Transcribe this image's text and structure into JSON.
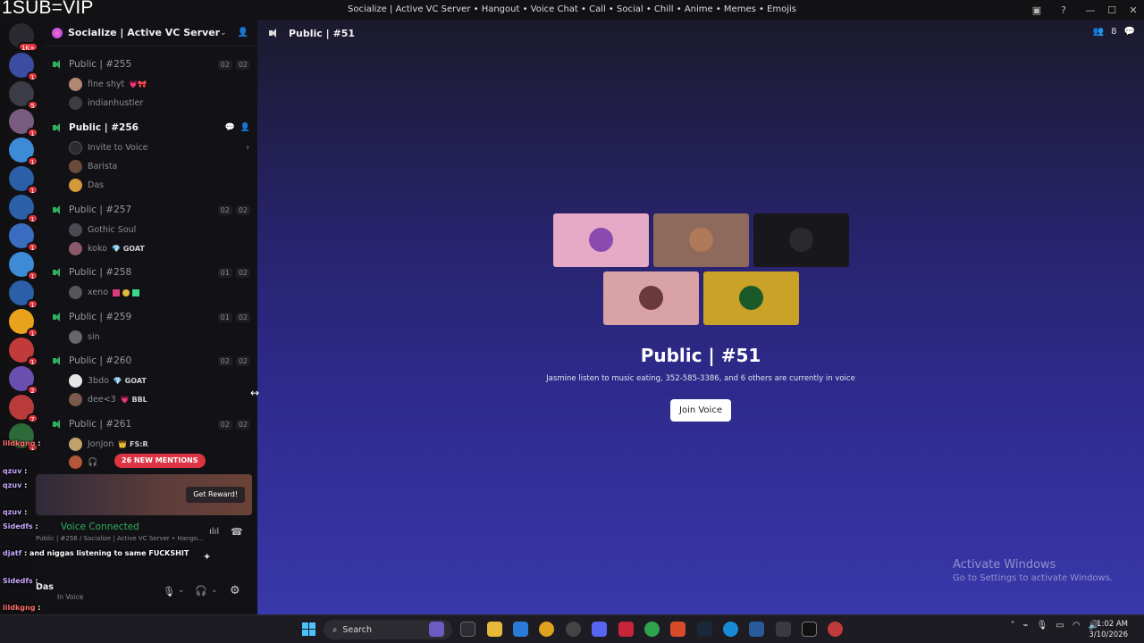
{
  "watermark": "1SUB=VIP",
  "window": {
    "title": "Socialize | Active VC Server • Hangout • Voice Chat • Call • Social • Chill • Anime • Memes • Emojis"
  },
  "guild_badges": [
    "1K+",
    "1",
    "5",
    "1",
    "1",
    "1",
    "1",
    "1",
    "1",
    "1",
    "1",
    "1",
    "2",
    "7",
    "1"
  ],
  "server": {
    "name": "Socialize | Active VC Server • Han..."
  },
  "channels": [
    {
      "name": "Public | #255",
      "counts": [
        "02",
        "02"
      ],
      "users": [
        {
          "name": "fine shyt",
          "tag": "💗🎀"
        },
        {
          "name": "indianhustler",
          "tag": ""
        }
      ]
    },
    {
      "name": "Public | #256",
      "counts": [],
      "active": true,
      "invite": "Invite to Voice",
      "users": [
        {
          "name": "Barista",
          "tag": ""
        },
        {
          "name": "Das",
          "tag": ""
        }
      ]
    },
    {
      "name": "Public | #257",
      "counts": [
        "02",
        "02"
      ],
      "users": [
        {
          "name": "Gothic Soul",
          "tag": ""
        },
        {
          "name": "koko",
          "tag": "💎 GOAT"
        }
      ]
    },
    {
      "name": "Public | #258",
      "counts": [
        "01",
        "02"
      ],
      "users": [
        {
          "name": "xeno",
          "tag": ""
        }
      ]
    },
    {
      "name": "Public | #259",
      "counts": [
        "01",
        "02"
      ],
      "users": [
        {
          "name": "sin",
          "tag": ""
        }
      ]
    },
    {
      "name": "Public | #260",
      "counts": [
        "02",
        "02"
      ],
      "users": [
        {
          "name": "3bdo",
          "tag": "💎 GOAT"
        },
        {
          "name": "dee<3",
          "tag": "💗 BBL"
        }
      ]
    },
    {
      "name": "Public | #261",
      "counts": [
        "02",
        "02"
      ],
      "users": [
        {
          "name": "JonJon",
          "tag": "👑 FS:R"
        }
      ]
    }
  ],
  "mentions_label": "26 NEW MENTIONS",
  "promo": {
    "button": "Get Reward!"
  },
  "voice": {
    "status": "Voice Connected",
    "location": "Public | #256 / Socialize | Active VC Server • Hango..."
  },
  "user": {
    "name": "Das",
    "status": "In Voice"
  },
  "chat_overlay": [
    {
      "user": "lildkgng",
      "msg": ""
    },
    {
      "user": "qzuv",
      "msg": ""
    },
    {
      "user": "qzuv",
      "msg": ""
    },
    {
      "user": "qzuv",
      "msg": ""
    },
    {
      "user": "Sidedfs",
      "msg": ""
    },
    {
      "user": "djatf",
      "msg": "and niggas listening to same FUCKSHIT"
    },
    {
      "user": "Sidedfs",
      "msg": ""
    },
    {
      "user": "lildkgng",
      "msg": ""
    },
    {
      "user": "Sidedfs",
      "msg": ""
    }
  ],
  "main": {
    "channel_title": "Public | #51",
    "member_count": "8",
    "hero_title": "Public | #51",
    "hero_sub": "Jasmine listen to music eating, 352-585-3386, and 6 others are currently in voice",
    "join_label": "Join Voice",
    "tile_colors": [
      "#e6a9c6",
      "#8e6a5c",
      "#18171b",
      "#d9a3a6",
      "#c9a227"
    ]
  },
  "activate": {
    "title": "Activate Windows",
    "sub": "Go to Settings to activate Windows."
  },
  "taskbar": {
    "search": "Search",
    "time": "1:02 AM",
    "date": "3/10/2026"
  }
}
